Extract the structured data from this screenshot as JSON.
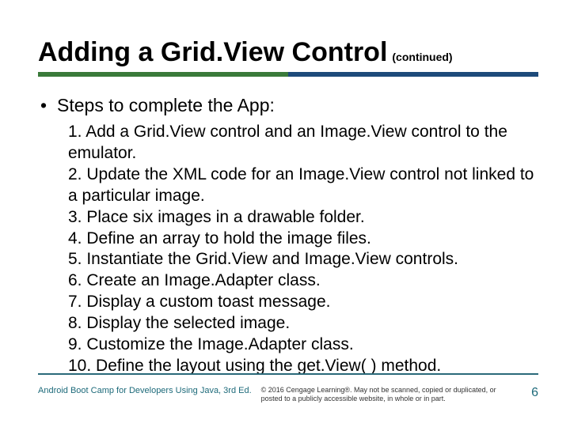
{
  "title": "Adding a Grid.View Control",
  "title_suffix": "(continued)",
  "bullet_label": "Steps to complete the App:",
  "steps": [
    "1. Add a Grid.View control and an Image.View control to the emulator.",
    "2. Update the XML code for an Image.View control not linked to a particular image.",
    "3. Place six images in a drawable folder.",
    "4. Define an array to hold the image files.",
    "5. Instantiate the Grid.View and Image.View controls.",
    "6. Create an Image.Adapter class.",
    "7. Display a custom toast message.",
    "8. Display the selected image.",
    "9. Customize the Image.Adapter class.",
    "10. Define the layout using the get.View( ) method."
  ],
  "footer": {
    "source": "Android Boot Camp for Developers Using Java, 3rd Ed.",
    "copyright": "© 2016 Cengage Learning®. May not be scanned, copied or duplicated, or posted to a publicly accessible website, in whole or in part.",
    "page_number": "6"
  }
}
